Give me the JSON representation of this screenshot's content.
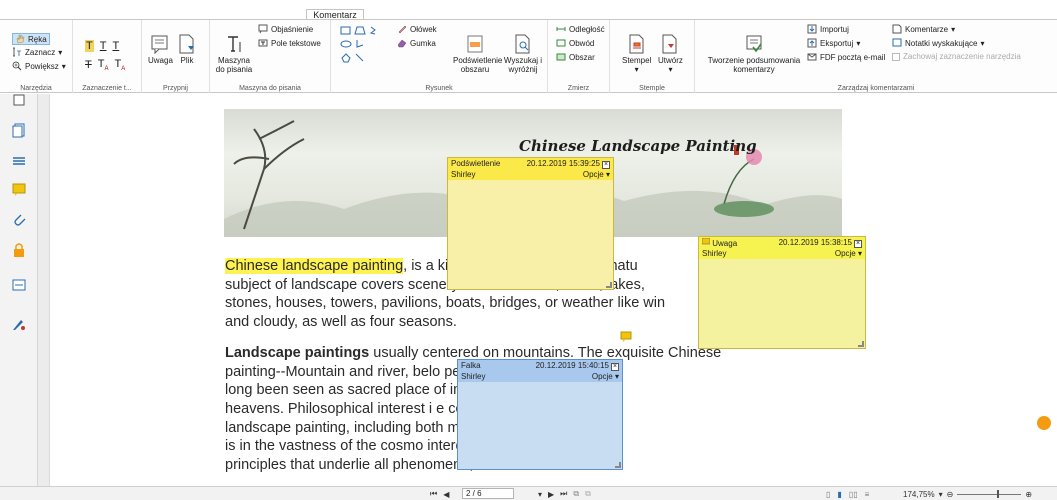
{
  "ribbon": {
    "active_tab": "Komentarz",
    "groups": {
      "narzedzia": {
        "label": "Narzędzia",
        "items": [
          "Ręka",
          "Zaznacz",
          "Powiększ"
        ]
      },
      "zaznaczenie": {
        "label": "Zaznaczenie t..."
      },
      "przypnij": {
        "label": "Przypnij",
        "items": [
          "Uwaga",
          "Plik"
        ]
      },
      "maszyna": {
        "label": "Maszyna do pisania",
        "big": "Maszyna do pisania",
        "items": [
          "Objaśnienie",
          "Pole tekstowe"
        ]
      },
      "rysunek": {
        "label": "Rysunek",
        "items": [
          "Ołówek",
          "Gumka"
        ],
        "big1": "Podświetlenie obszaru",
        "big2": "Wyszukaj i wyróżnij"
      },
      "zmierz": {
        "label": "Zmierz",
        "items": [
          "Odległość",
          "Obwód",
          "Obszar"
        ]
      },
      "stemple": {
        "label": "Stemple",
        "items": [
          "Stempel",
          "Utwórz"
        ]
      },
      "zarzadzaj": {
        "label": "Zarządzaj komentarzami",
        "big": "Tworzenie podsumowania komentarzy",
        "items": [
          "Importuj",
          "Eksportuj",
          "FDF pocztą e-mail",
          "Komentarze",
          "Notatki wyskakujące",
          "Zachowaj zaznaczenie narzędzia"
        ]
      }
    }
  },
  "document": {
    "banner_title": "Chinese Landscape Painting",
    "para1": [
      {
        "hl": "Chinese landscape painting",
        "rest": ", is a kind of painting describing natu"
      },
      {
        "text": "subject of landscape covers scenery like mountains, rivers, lakes,"
      },
      {
        "text": "stones, houses, towers, pavilions, boats, bridges, or weather like win"
      },
      {
        "text": "and cloudy, as well as four seasons."
      }
    ],
    "para2": [
      {
        "bold": "Landscape paintings",
        "rest": " usually centered on mountains. The exquisite Chinese"
      },
      {
        "text": "painting--Mountain and river, belo                    pe painting. Mountains had"
      },
      {
        "text": "long been seen as sacred place                    of immortals, close to the"
      },
      {
        "text": "heavens. Philosophical interest i                    e contributed to the rise of"
      },
      {
        "text": "landscape painting, including both                    minor the human presence"
      },
      {
        "text": "is in the vastness of the cosmo                    interest in the patterns or"
      },
      {
        "text": "principles that underlie all phenomena, natural and social."
      }
    ]
  },
  "notes": [
    {
      "title": "Podświetlenie",
      "date": "20.12.2019 15:39:25",
      "author": "Shirley",
      "options": "Opcje",
      "color": "#f8f0a8"
    },
    {
      "title": "Uwaga",
      "date": "20.12.2019 15:38:15",
      "author": "Shirley",
      "options": "Opcje",
      "color": "#f4f29e"
    },
    {
      "title": "Falka",
      "date": "20.12.2019 15:40:15",
      "author": "Shirley",
      "options": "Opcje",
      "color": "#c8dcf2"
    }
  ],
  "statusbar": {
    "page": "2 / 6",
    "zoom": "174,75%"
  }
}
